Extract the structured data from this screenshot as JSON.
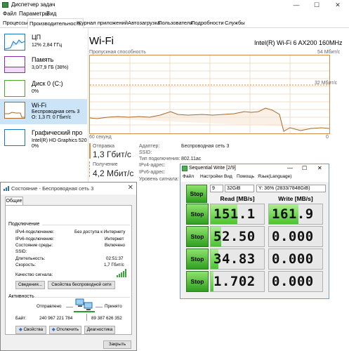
{
  "task_manager": {
    "title": "Диспетчер задач",
    "caption_buttons": [
      "—",
      "☐",
      "✕"
    ],
    "menu": [
      "Файл",
      "Параметры",
      "Вид"
    ],
    "tabs": [
      "Процессы",
      "Производительность",
      "Журнал приложений",
      "Автозагрузка",
      "Пользователи",
      "Подробности",
      "Службы"
    ],
    "active_tab": "Производительность",
    "sidebar": [
      {
        "name": "ЦП",
        "line1": "12% 2,84 ГГц",
        "line2": "",
        "color": "#1a78c2"
      },
      {
        "name": "Память",
        "line1": "3,0/7,9 ГБ (38%)",
        "line2": "",
        "color": "#8b2fa8"
      },
      {
        "name": "Диск 0 (C:)",
        "line1": "0%",
        "line2": "",
        "color": "#4ca82a"
      },
      {
        "name": "Wi-Fi",
        "line1": "Беспроводная сеть 3",
        "line2": "О: 1,3 П: 0 Гбит/с",
        "color": "#a36b2f"
      },
      {
        "name": "Графический про",
        "line1": "Intel(R) HD Graphics 520",
        "line2": "0%",
        "color": "#1a78c2"
      }
    ],
    "wifi": {
      "title": "Wi-Fi",
      "adapter": "Intel(R) Wi-Fi 6 AX200 160MHz",
      "throughput_label": "Пропускная способность",
      "max_label": "54 Мбит/с",
      "mid_label": "32 Мбит/с",
      "seconds_label": "60 секунд",
      "zero_label": "0",
      "send_label": "Отправка",
      "send_value": "1,3 Гбит/с",
      "receive_label": "Получение",
      "receive_value": "4,2 Мбит/с",
      "details": [
        {
          "k": "Адаптер:",
          "v": "Беспроводная сеть 3"
        },
        {
          "k": "SSID:",
          "v": ""
        },
        {
          "k": "Тип подключения:",
          "v": "802.11ac"
        },
        {
          "k": "IPv4-адрес:",
          "v": ""
        },
        {
          "k": "IPv6-адрес:",
          "v": ""
        },
        {
          "k": "Уровень сигнала:",
          "v": ""
        }
      ]
    }
  },
  "status_dialog": {
    "title": "Состояние - Беспроводная сеть 3",
    "close": "✕",
    "tab": "Общие",
    "connection_header": "Подключение",
    "rows": [
      {
        "k": "IPv4-подключение:",
        "v": "Без доступа к Интернету"
      },
      {
        "k": "IPv6-подключение:",
        "v": "Интернет"
      },
      {
        "k": "Состояние среды:",
        "v": "Включено"
      },
      {
        "k": "SSID:",
        "v": ""
      },
      {
        "k": "Длительность:",
        "v": "02:51:37"
      },
      {
        "k": "Скорость:",
        "v": "1,7 Гбит/с"
      }
    ],
    "signal_label": "Качество сигнала:",
    "details_button": "Сведения...",
    "wireless_props_button": "Свойства беспроводной сети",
    "activity_header": "Активность",
    "sent_label": "Отправлено",
    "received_label": "Принято",
    "bytes_label": "Байт:",
    "bytes_sent": "240 967 221 784",
    "bytes_received": "89 387 626 352",
    "properties_button": "Свойства",
    "disable_button": "Отключить",
    "diagnose_button": "Диагностика",
    "close_button": "Закрыть"
  },
  "seq_write": {
    "title": "Sequential Write [2/9]",
    "caption_buttons": [
      "—",
      "☐",
      "✕"
    ],
    "menu": [
      "Файл",
      "Настройки",
      "Вид",
      "Помощь",
      "Язык(Language)"
    ],
    "top_stop": "Stop",
    "count": "9",
    "size": "32GiB",
    "drive": "Y: 36% (2833/7848GiB)",
    "read_header": "Read [MB/s]",
    "write_header": "Write [MB/s]",
    "rows": [
      {
        "stop": "Stop",
        "read": "151.1",
        "write": "161.9",
        "read_fill": 0.5,
        "write_fill": 0.55
      },
      {
        "stop": "Stop",
        "read": "52.50",
        "write": "0.000",
        "read_fill": 0.2,
        "write_fill": 0
      },
      {
        "stop": "Stop",
        "read": "34.83",
        "write": "0.000",
        "read_fill": 0.15,
        "write_fill": 0
      },
      {
        "stop": "Stop",
        "read": "1.702",
        "write": "0.000",
        "read_fill": 0.05,
        "write_fill": 0
      }
    ]
  }
}
